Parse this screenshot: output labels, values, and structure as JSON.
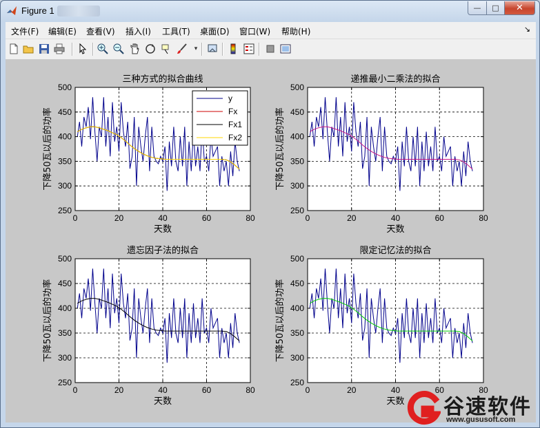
{
  "window": {
    "title": "Figure 1",
    "min_label": "—",
    "max_label": "□",
    "close_label": "✕"
  },
  "menu": {
    "items": [
      "文件(F)",
      "编辑(E)",
      "查看(V)",
      "插入(I)",
      "工具(T)",
      "桌面(D)",
      "窗口(W)",
      "帮助(H)"
    ],
    "arrow": "↘"
  },
  "toolbar": {
    "icons": [
      "new-figure-icon",
      "open-icon",
      "save-icon",
      "print-icon",
      "pointer-icon",
      "zoom-in-icon",
      "zoom-out-icon",
      "pan-icon",
      "rotate-icon",
      "data-cursor-icon",
      "brush-icon",
      "link-icon",
      "colorbar-icon",
      "legend-icon",
      "hide-tools-icon",
      "show-tools-icon"
    ]
  },
  "colors": {
    "y": "#00008b",
    "Fx": "#cc0000",
    "Fx1": "#000000",
    "Fx2": "#ffd700",
    "recursive": "#c71585",
    "limited_memory": "#00cc00"
  },
  "chart_data": [
    {
      "type": "line",
      "title": "三种方式的拟合曲线",
      "xlabel": "天数",
      "ylabel": "下降50瓦以后的功率",
      "xlim": [
        0,
        80
      ],
      "ylim": [
        250,
        500
      ],
      "xticks": [
        0,
        20,
        40,
        60,
        80
      ],
      "yticks": [
        250,
        300,
        350,
        400,
        450,
        500
      ],
      "grid": true,
      "legend": {
        "placement": "top-right",
        "entries": [
          "y",
          "Fx",
          "Fx1",
          "Fx2"
        ]
      },
      "series": [
        {
          "name": "y",
          "color_key": "y",
          "ref": "y"
        },
        {
          "name": "Fx",
          "color_key": "Fx",
          "ref": "fit"
        },
        {
          "name": "Fx1",
          "color_key": "Fx1",
          "ref": "fit"
        },
        {
          "name": "Fx2",
          "color_key": "Fx2",
          "ref": "fit"
        }
      ]
    },
    {
      "type": "line",
      "title": "递推最小二乘法的拟合",
      "xlabel": "天数",
      "ylabel": "下降50瓦以后的功率",
      "xlim": [
        0,
        80
      ],
      "ylim": [
        250,
        500
      ],
      "xticks": [
        0,
        20,
        40,
        60,
        80
      ],
      "yticks": [
        250,
        300,
        350,
        400,
        450,
        500
      ],
      "grid": true,
      "series": [
        {
          "color_key": "y",
          "ref": "y"
        },
        {
          "color_key": "recursive",
          "ref": "fit"
        }
      ]
    },
    {
      "type": "line",
      "title": "遗忘因子法的拟合",
      "xlabel": "天数",
      "ylabel": "下降50瓦以后的功率",
      "xlim": [
        0,
        80
      ],
      "ylim": [
        250,
        500
      ],
      "xticks": [
        0,
        20,
        40,
        60,
        80
      ],
      "yticks": [
        250,
        300,
        350,
        400,
        450,
        500
      ],
      "grid": true,
      "series": [
        {
          "color_key": "y",
          "ref": "y"
        },
        {
          "color_key": "Fx1",
          "ref": "fit"
        }
      ]
    },
    {
      "type": "line",
      "title": "限定记忆法的拟合",
      "xlabel": "天数",
      "ylabel": "下降50瓦以后的功率",
      "xlim": [
        0,
        80
      ],
      "ylim": [
        250,
        500
      ],
      "xticks": [
        0,
        20,
        40,
        60,
        80
      ],
      "yticks": [
        250,
        300,
        350,
        400,
        450,
        500
      ],
      "grid": true,
      "series": [
        {
          "color_key": "y",
          "ref": "y"
        },
        {
          "color_key": "limited_memory",
          "ref": "fit"
        }
      ]
    }
  ],
  "series_values": {
    "y_x": [
      1,
      2,
      3,
      4,
      5,
      6,
      7,
      8,
      9,
      10,
      11,
      12,
      13,
      14,
      15,
      16,
      17,
      18,
      19,
      20,
      21,
      22,
      23,
      24,
      25,
      26,
      27,
      28,
      29,
      30,
      31,
      32,
      33,
      34,
      35,
      36,
      37,
      38,
      39,
      40,
      41,
      42,
      43,
      44,
      45,
      46,
      47,
      48,
      49,
      50,
      51,
      52,
      53,
      54,
      55,
      56,
      57,
      58,
      59,
      60,
      61,
      62,
      63,
      64,
      65,
      66,
      67,
      68,
      69,
      70,
      71,
      72,
      73,
      74,
      75
    ],
    "y": [
      400,
      430,
      380,
      440,
      420,
      460,
      395,
      480,
      410,
      350,
      420,
      400,
      480,
      380,
      440,
      360,
      470,
      390,
      420,
      370,
      470,
      410,
      380,
      430,
      335,
      360,
      440,
      300,
      420,
      380,
      350,
      400,
      440,
      330,
      420,
      360,
      350,
      345,
      360,
      350,
      380,
      290,
      390,
      340,
      420,
      350,
      330,
      400,
      340,
      420,
      300,
      390,
      330,
      410,
      340,
      380,
      330,
      420,
      350,
      360,
      330,
      400,
      360,
      370,
      380,
      300,
      360,
      330,
      350,
      300,
      370,
      320,
      390,
      350,
      330
    ],
    "fit_x": [
      1,
      3,
      5,
      7,
      9,
      11,
      13,
      15,
      17,
      19,
      21,
      23,
      25,
      27,
      29,
      31,
      33,
      35,
      37,
      39,
      41,
      43,
      45,
      47,
      49,
      51,
      53,
      55,
      57,
      59,
      61,
      63,
      65,
      67,
      69,
      71,
      73,
      75
    ],
    "fit": [
      410,
      415,
      418,
      420,
      420,
      418,
      415,
      412,
      408,
      404,
      398,
      391,
      383,
      376,
      370,
      365,
      361,
      358,
      356,
      355,
      354,
      354,
      354,
      354,
      354,
      354,
      354,
      354,
      354,
      354,
      354,
      354,
      354,
      354,
      353,
      349,
      342,
      334
    ]
  },
  "watermark": {
    "brand": "谷速软件",
    "url": "www.gususoft.com"
  }
}
